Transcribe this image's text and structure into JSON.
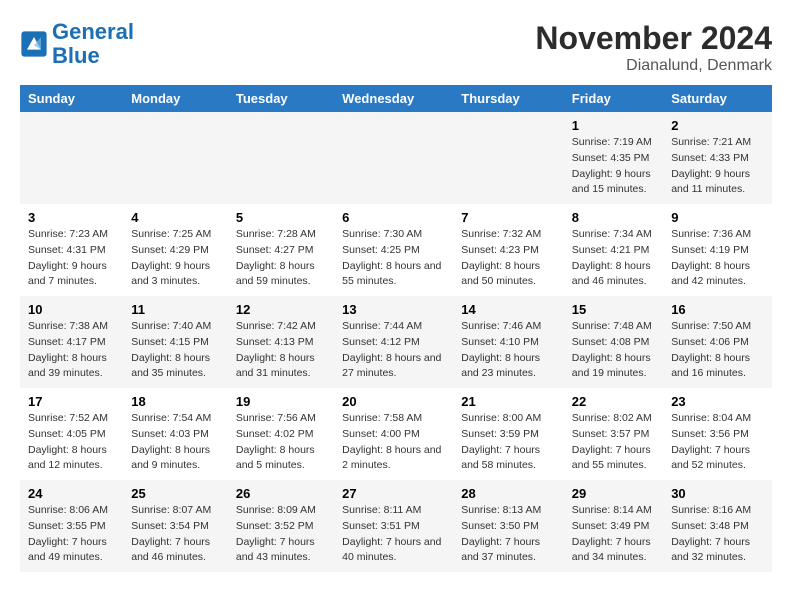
{
  "header": {
    "logo_line1": "General",
    "logo_line2": "Blue",
    "month": "November 2024",
    "location": "Dianalund, Denmark"
  },
  "weekdays": [
    "Sunday",
    "Monday",
    "Tuesday",
    "Wednesday",
    "Thursday",
    "Friday",
    "Saturday"
  ],
  "weeks": [
    [
      {
        "day": "",
        "sunrise": "",
        "sunset": "",
        "daylight": ""
      },
      {
        "day": "",
        "sunrise": "",
        "sunset": "",
        "daylight": ""
      },
      {
        "day": "",
        "sunrise": "",
        "sunset": "",
        "daylight": ""
      },
      {
        "day": "",
        "sunrise": "",
        "sunset": "",
        "daylight": ""
      },
      {
        "day": "",
        "sunrise": "",
        "sunset": "",
        "daylight": ""
      },
      {
        "day": "1",
        "sunrise": "Sunrise: 7:19 AM",
        "sunset": "Sunset: 4:35 PM",
        "daylight": "Daylight: 9 hours and 15 minutes."
      },
      {
        "day": "2",
        "sunrise": "Sunrise: 7:21 AM",
        "sunset": "Sunset: 4:33 PM",
        "daylight": "Daylight: 9 hours and 11 minutes."
      }
    ],
    [
      {
        "day": "3",
        "sunrise": "Sunrise: 7:23 AM",
        "sunset": "Sunset: 4:31 PM",
        "daylight": "Daylight: 9 hours and 7 minutes."
      },
      {
        "day": "4",
        "sunrise": "Sunrise: 7:25 AM",
        "sunset": "Sunset: 4:29 PM",
        "daylight": "Daylight: 9 hours and 3 minutes."
      },
      {
        "day": "5",
        "sunrise": "Sunrise: 7:28 AM",
        "sunset": "Sunset: 4:27 PM",
        "daylight": "Daylight: 8 hours and 59 minutes."
      },
      {
        "day": "6",
        "sunrise": "Sunrise: 7:30 AM",
        "sunset": "Sunset: 4:25 PM",
        "daylight": "Daylight: 8 hours and 55 minutes."
      },
      {
        "day": "7",
        "sunrise": "Sunrise: 7:32 AM",
        "sunset": "Sunset: 4:23 PM",
        "daylight": "Daylight: 8 hours and 50 minutes."
      },
      {
        "day": "8",
        "sunrise": "Sunrise: 7:34 AM",
        "sunset": "Sunset: 4:21 PM",
        "daylight": "Daylight: 8 hours and 46 minutes."
      },
      {
        "day": "9",
        "sunrise": "Sunrise: 7:36 AM",
        "sunset": "Sunset: 4:19 PM",
        "daylight": "Daylight: 8 hours and 42 minutes."
      }
    ],
    [
      {
        "day": "10",
        "sunrise": "Sunrise: 7:38 AM",
        "sunset": "Sunset: 4:17 PM",
        "daylight": "Daylight: 8 hours and 39 minutes."
      },
      {
        "day": "11",
        "sunrise": "Sunrise: 7:40 AM",
        "sunset": "Sunset: 4:15 PM",
        "daylight": "Daylight: 8 hours and 35 minutes."
      },
      {
        "day": "12",
        "sunrise": "Sunrise: 7:42 AM",
        "sunset": "Sunset: 4:13 PM",
        "daylight": "Daylight: 8 hours and 31 minutes."
      },
      {
        "day": "13",
        "sunrise": "Sunrise: 7:44 AM",
        "sunset": "Sunset: 4:12 PM",
        "daylight": "Daylight: 8 hours and 27 minutes."
      },
      {
        "day": "14",
        "sunrise": "Sunrise: 7:46 AM",
        "sunset": "Sunset: 4:10 PM",
        "daylight": "Daylight: 8 hours and 23 minutes."
      },
      {
        "day": "15",
        "sunrise": "Sunrise: 7:48 AM",
        "sunset": "Sunset: 4:08 PM",
        "daylight": "Daylight: 8 hours and 19 minutes."
      },
      {
        "day": "16",
        "sunrise": "Sunrise: 7:50 AM",
        "sunset": "Sunset: 4:06 PM",
        "daylight": "Daylight: 8 hours and 16 minutes."
      }
    ],
    [
      {
        "day": "17",
        "sunrise": "Sunrise: 7:52 AM",
        "sunset": "Sunset: 4:05 PM",
        "daylight": "Daylight: 8 hours and 12 minutes."
      },
      {
        "day": "18",
        "sunrise": "Sunrise: 7:54 AM",
        "sunset": "Sunset: 4:03 PM",
        "daylight": "Daylight: 8 hours and 9 minutes."
      },
      {
        "day": "19",
        "sunrise": "Sunrise: 7:56 AM",
        "sunset": "Sunset: 4:02 PM",
        "daylight": "Daylight: 8 hours and 5 minutes."
      },
      {
        "day": "20",
        "sunrise": "Sunrise: 7:58 AM",
        "sunset": "Sunset: 4:00 PM",
        "daylight": "Daylight: 8 hours and 2 minutes."
      },
      {
        "day": "21",
        "sunrise": "Sunrise: 8:00 AM",
        "sunset": "Sunset: 3:59 PM",
        "daylight": "Daylight: 7 hours and 58 minutes."
      },
      {
        "day": "22",
        "sunrise": "Sunrise: 8:02 AM",
        "sunset": "Sunset: 3:57 PM",
        "daylight": "Daylight: 7 hours and 55 minutes."
      },
      {
        "day": "23",
        "sunrise": "Sunrise: 8:04 AM",
        "sunset": "Sunset: 3:56 PM",
        "daylight": "Daylight: 7 hours and 52 minutes."
      }
    ],
    [
      {
        "day": "24",
        "sunrise": "Sunrise: 8:06 AM",
        "sunset": "Sunset: 3:55 PM",
        "daylight": "Daylight: 7 hours and 49 minutes."
      },
      {
        "day": "25",
        "sunrise": "Sunrise: 8:07 AM",
        "sunset": "Sunset: 3:54 PM",
        "daylight": "Daylight: 7 hours and 46 minutes."
      },
      {
        "day": "26",
        "sunrise": "Sunrise: 8:09 AM",
        "sunset": "Sunset: 3:52 PM",
        "daylight": "Daylight: 7 hours and 43 minutes."
      },
      {
        "day": "27",
        "sunrise": "Sunrise: 8:11 AM",
        "sunset": "Sunset: 3:51 PM",
        "daylight": "Daylight: 7 hours and 40 minutes."
      },
      {
        "day": "28",
        "sunrise": "Sunrise: 8:13 AM",
        "sunset": "Sunset: 3:50 PM",
        "daylight": "Daylight: 7 hours and 37 minutes."
      },
      {
        "day": "29",
        "sunrise": "Sunrise: 8:14 AM",
        "sunset": "Sunset: 3:49 PM",
        "daylight": "Daylight: 7 hours and 34 minutes."
      },
      {
        "day": "30",
        "sunrise": "Sunrise: 8:16 AM",
        "sunset": "Sunset: 3:48 PM",
        "daylight": "Daylight: 7 hours and 32 minutes."
      }
    ]
  ]
}
